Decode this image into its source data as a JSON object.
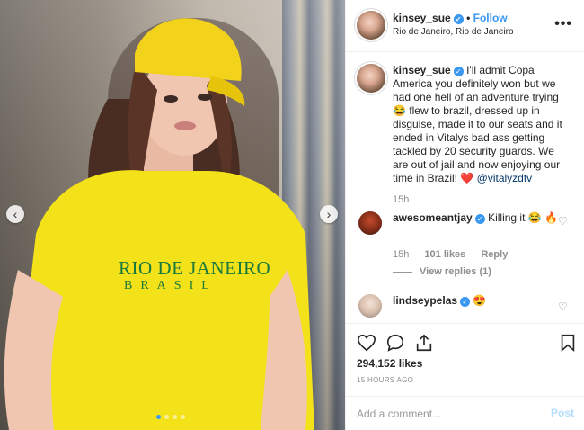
{
  "photo": {
    "alt_shirt_line1": "RIO DE JANEIRO",
    "alt_shirt_line2": "BRASIL",
    "carousel_total": 4,
    "carousel_active": 1
  },
  "header": {
    "username": "kinsey_sue",
    "follow_label": "Follow",
    "location": "Rio de Janeiro, Rio de Janeiro",
    "more_label": "•••"
  },
  "caption": {
    "username": "kinsey_sue",
    "text": "I'll admit Copa America you definitely won but we had one hell of an adventure trying 😂 flew to brazil, dressed up in disguise, made it to our seats and it ended in Vitalys bad ass getting tackled by 20 security guards. We are out of jail and now enjoying our time in Brazil! ❤️",
    "mention": "@vitalyzdtv",
    "age": "15h"
  },
  "comments": [
    {
      "username": "awesomeantjay",
      "text": "Killing it 😂 🔥",
      "age": "15h",
      "likes": "101 likes",
      "reply_label": "Reply",
      "view_replies": "View replies (1)"
    },
    {
      "username": "lindseypelas",
      "text": "😍"
    }
  ],
  "actions": {
    "likes_count": "294,152 likes",
    "timestamp": "15 HOURS AGO"
  },
  "composer": {
    "placeholder": "Add a comment...",
    "post_label": "Post"
  },
  "colors": {
    "accent": "#3897f0",
    "text": "#262626",
    "muted": "#8e8e8e",
    "heart": "#ed4956"
  }
}
